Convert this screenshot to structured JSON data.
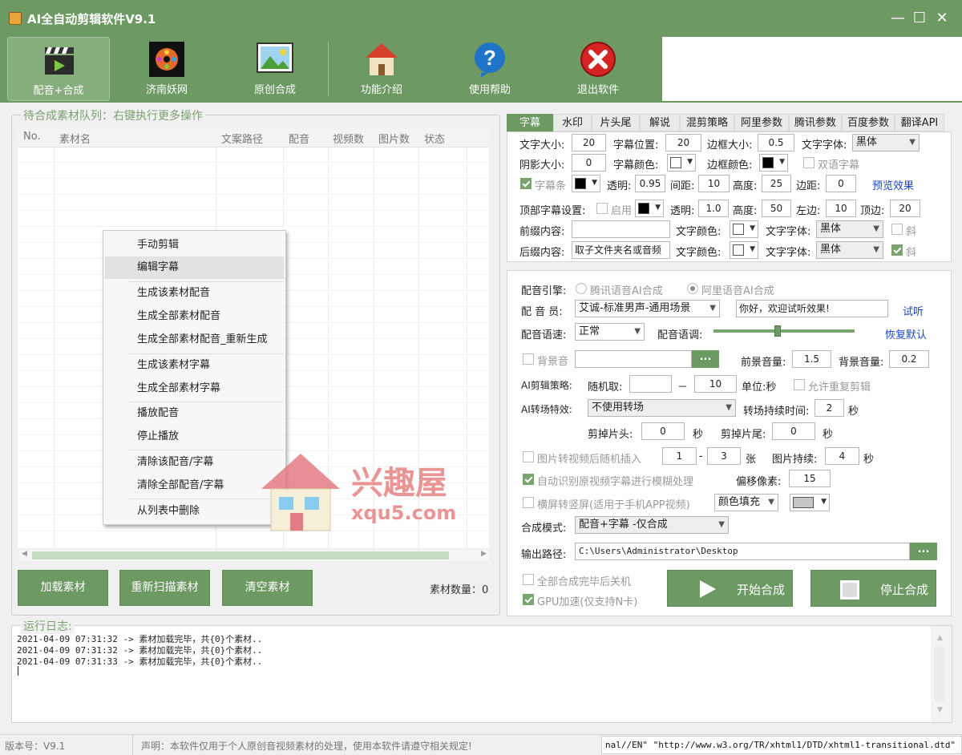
{
  "window": {
    "title": "AI全自动剪辑软件V9.1"
  },
  "toolbar": {
    "buttons": [
      {
        "label": "配音+合成"
      },
      {
        "label": "济南妖网"
      },
      {
        "label": "原创合成"
      },
      {
        "label": "功能介绍"
      },
      {
        "label": "使用帮助"
      },
      {
        "label": "退出软件"
      }
    ]
  },
  "queue": {
    "group_label": "待合成素材队列：右键执行更多操作",
    "columns": [
      "No.",
      "素材名",
      "文案路径",
      "配音",
      "视频数",
      "图片数",
      "状态"
    ],
    "buttons": {
      "load": "加载素材",
      "rescan": "重新扫描素材",
      "clear": "清空素材"
    },
    "count_label": "素材数量：",
    "count_value": "0"
  },
  "context_menu": {
    "items": [
      "手动剪辑",
      "编辑字幕",
      "生成该素材配音",
      "生成全部素材配音",
      "生成全部素材配音_重新生成",
      "生成该素材字幕",
      "生成全部素材字幕",
      "播放配音",
      "停止播放",
      "清除该配音/字幕",
      "清除全部配音/字幕",
      "从列表中删除"
    ]
  },
  "tabs": [
    "字幕",
    "水印",
    "片头尾",
    "解说",
    "混剪策略",
    "阿里参数",
    "腾讯参数",
    "百度参数",
    "翻译API"
  ],
  "subtitle": {
    "font_size_label": "文字大小:",
    "font_size": "20",
    "position_label": "字幕位置:",
    "position": "20",
    "border_size_label": "边框大小:",
    "border_size": "0.5",
    "font_label": "文字字体:",
    "font": "黑体",
    "shadow_label": "阴影大小:",
    "shadow": "0",
    "color_label": "字幕颜色:",
    "border_color_label": "边框颜色:",
    "bilingual_label": "双语字幕",
    "bar_label": "字幕条",
    "alpha_label": "透明:",
    "alpha": "0.95",
    "gap_label": "间距:",
    "gap": "10",
    "height_label": "高度:",
    "height": "25",
    "margin_label": "边距:",
    "margin": "0",
    "preview": "预览效果",
    "top_label": "顶部字幕设置:",
    "top_enable": "启用",
    "top_alpha": "1.0",
    "top_height": "50",
    "left_label": "左边:",
    "left": "10",
    "topm_label": "顶边:",
    "topm": "20",
    "prefix_label": "前缀内容:",
    "prefix": "",
    "text_color_label": "文字颜色:",
    "prefix_font": "黑体",
    "italic": "斜",
    "suffix_label": "后缀内容:",
    "suffix": "取子文件夹名或音频",
    "suffix_font": "黑体"
  },
  "voice": {
    "engine_label": "配音引擎:",
    "engine_tencent": "腾讯语音AI合成",
    "engine_ali": "阿里语音AI合成",
    "voicer_label": "配 音 员:",
    "voicer": "艾诚-标准男声-通用场景",
    "test_text": "你好，欢迎试听效果!",
    "listen": "试听",
    "speed_label": "配音语速:",
    "speed": "正常",
    "tone_label": "配音语调:",
    "reset": "恢复默认",
    "tone_level": 0.45,
    "bgm_label": "背景音",
    "bgm_path": "",
    "browse": "...",
    "fg_vol_label": "前景音量:",
    "fg_vol": "1.5",
    "bg_vol_label": "背景音量:",
    "bg_vol": "0.2",
    "strategy_label": "AI剪辑策略:",
    "random_label": "随机取:",
    "random_from": "",
    "dash": "－",
    "random_to": "10",
    "unit_label": "单位:秒",
    "repeat_label": "允许重复剪辑",
    "transition_label": "AI转场特效:",
    "transition": "不使用转场",
    "trans_dur_label": "转场持续时间:",
    "trans_dur": "2",
    "sec": "秒",
    "cut_head_label": "剪掉片头:",
    "cut_head": "0",
    "cut_tail_label": "剪掉片尾:",
    "cut_tail": "0",
    "img_insert_label": "图片转视频后随机插入",
    "img_from": "1",
    "img_dash": "-",
    "img_to": "3",
    "zhang": "张",
    "img_dur_label": "图片持续:",
    "img_dur": "4",
    "blur_label": "自动识别原视频字幕进行模糊处理",
    "offset_label": "偏移像素:",
    "offset": "15",
    "vertical_label": "横屏转竖屏(适用于手机APP视频)",
    "fill": "颜色填充",
    "mode_label": "合成模式:",
    "mode": "配音+字幕 -仅合成",
    "output_label": "输出路径:",
    "output": "C:\\Users\\Administrator\\Desktop",
    "shutdown_label": "全部合成完毕后关机",
    "gpu_label": "GPU加速(仅支持N卡)",
    "start": "开始合成",
    "stop": "停止合成"
  },
  "log": {
    "label": "运行日志:",
    "lines": [
      "2021-04-09 07:31:32 -> 素材加载完毕，共{0}个素材..",
      "2021-04-09 07:31:32 -> 素材加载完毕，共{0}个素材..",
      "2021-04-09 07:31:33 -> 素材加载完毕，共{0}个素材.."
    ]
  },
  "status": {
    "version": "版本号：V9.1",
    "notice": "声明：本软件仅用于个人原创音视频素材的处理，使用本软件请遵守相关规定!",
    "url": "nal//EN\" \"http://www.w3.org/TR/xhtml1/DTD/xhtml1-transitional.dtd\""
  },
  "watermark": {
    "text": "兴趣屋",
    "site": "xqu5.com"
  },
  "colors": {
    "accent": "#6c9a62",
    "link": "#1a45c8"
  }
}
